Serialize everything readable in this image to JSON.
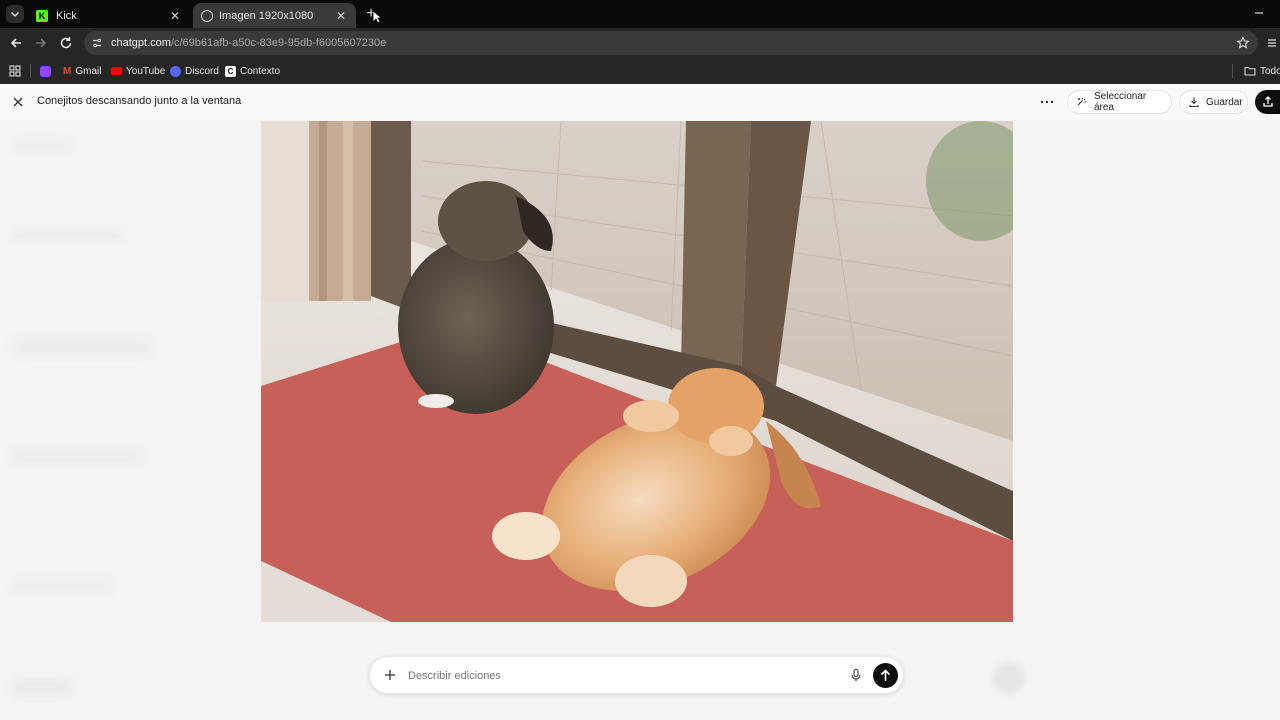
{
  "browser": {
    "tabs": [
      {
        "title": "Kick",
        "active": false,
        "icon": "kick-logo-icon"
      },
      {
        "title": "Imagen 1920x1080",
        "active": true,
        "icon": "chatgpt-logo-icon"
      }
    ],
    "url_host": "chatgpt.com",
    "url_path": "/c/69b61afb-a50c-83e9-95db-f6005607230e",
    "bookmarks": [
      {
        "label": "Gmail",
        "icon": "gmail-icon",
        "color": "#ea4335"
      },
      {
        "label": "YouTube",
        "icon": "youtube-icon",
        "color": "#ff0000"
      },
      {
        "label": "Discord",
        "icon": "discord-icon",
        "color": "#5865f2"
      },
      {
        "label": "Contexto",
        "icon": "contexto-icon",
        "color": "#ffffff"
      }
    ],
    "other_bookmarks_label": "Todo"
  },
  "editor": {
    "title": "Conejitos descansando junto a la ventana",
    "select_area_label": "Seleccionar área",
    "save_label": "Guardar",
    "image_alt": "two rabbits resting by a glass door on a red mat"
  },
  "composer": {
    "placeholder": "Describir ediciones"
  },
  "colors": {
    "accent_kick": "#53fc18",
    "send_button": "#0d0d0d",
    "mat": "#c8605a"
  }
}
